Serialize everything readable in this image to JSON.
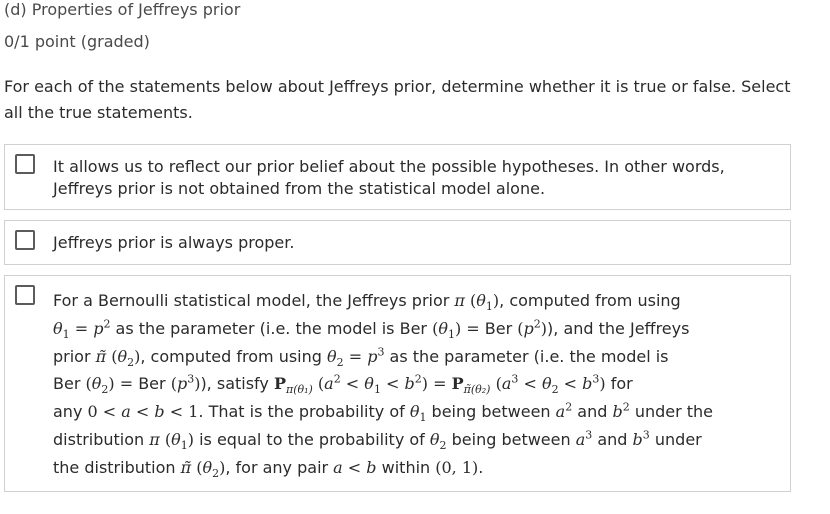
{
  "problem": {
    "title": "(d) Properties of Jeffreys prior",
    "score": "0/1 point (graded)",
    "instructions": "For each of the statements below about Jeffreys prior, determine whether it is true or false. Select all the true statements."
  },
  "options": [
    {
      "text": "It allows us to reflect our prior belief about the possible hypotheses. In other words, Jeffreys prior is not obtained from the statistical model alone.",
      "checked": false
    },
    {
      "text": "Jeffreys prior is always proper.",
      "checked": false
    },
    {
      "checked": false,
      "t1": "For a Bernoulli statistical model, the Jeffreys prior ",
      "t2": ", computed from using",
      "t3": " as the parameter (i.e. the model is ",
      "t4": "), and the Jeffreys",
      "t5": "prior ",
      "t6": ", computed from using ",
      "t7": " as the parameter (i.e. the model is",
      "t8": "), satisfy ",
      "t9": " for",
      "t10": "any ",
      "t11": ". That is the probability of ",
      "t12": " being between ",
      "t13": " and ",
      "t14": " under the",
      "t15": "distribution ",
      "t16": " is equal to the probability of ",
      "t17": " being between ",
      "t18": " and ",
      "t19": " under",
      "t20": "the distribution ",
      "t21": ", for any pair ",
      "t22": " within ",
      "t23": "."
    }
  ]
}
